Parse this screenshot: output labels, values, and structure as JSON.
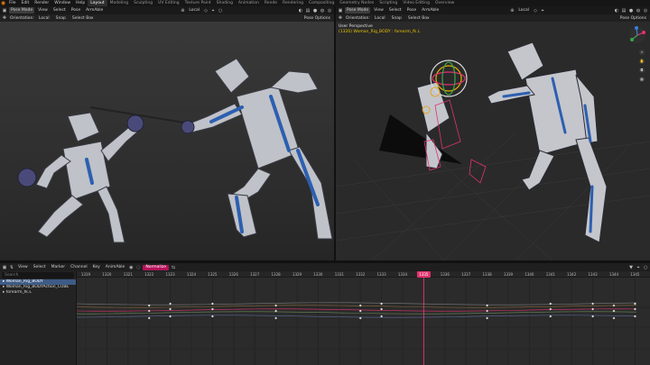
{
  "app": {
    "menu": [
      "File",
      "Edit",
      "Render",
      "Window",
      "Help"
    ],
    "workspaces": [
      "Layout",
      "Modeling",
      "Sculpting",
      "UV Editing",
      "Texture Paint",
      "Shading",
      "Animation",
      "Rende",
      "Rendering",
      "Compositing",
      "Geometry Nodes",
      "Scripting",
      "Video Editing",
      "Overview"
    ],
    "active_workspace": "Layout",
    "accent_color": "#e0336e",
    "brand_color": "#e87d0d"
  },
  "left_viewport": {
    "mode": "Pose Mode",
    "menus": [
      "View",
      "Select",
      "Pose",
      "ArmAble"
    ],
    "orientation_label": "Orientation:",
    "orientation_value": "Local",
    "snap_label": "Snap",
    "select_mode": "Select Box",
    "transform_space": "Local",
    "pose_options": "Pose Options"
  },
  "right_viewport": {
    "mode": "Pose Mode",
    "menus": [
      "View",
      "Select",
      "Pose",
      "ArmAble"
    ],
    "orientation_label": "Orientation:",
    "orientation_value": "Local",
    "snap_label": "Snap",
    "select_mode": "Select Box",
    "transform_space": "Local",
    "pose_options": "Pose Options",
    "view_name": "User Perspective",
    "object_info": "(1320) Woman_Rig_BODY : forearm_fk.L"
  },
  "graph_editor": {
    "menus": [
      "View",
      "Select",
      "Marker",
      "Channel",
      "Key",
      "AnimAble"
    ],
    "mode_label": "Normalize",
    "search_placeholder": "Search",
    "channels": [
      {
        "label": "Woman_Rig_BODY",
        "selected": true
      },
      {
        "label": "Woman_Rig_BODYAction_CUBE",
        "selected": false
      },
      {
        "label": "forearm_fk.L",
        "selected": false
      }
    ],
    "frames": [
      "1319",
      "1320",
      "1321",
      "1322",
      "1323",
      "1324",
      "1325",
      "1326",
      "1327",
      "1328",
      "1329",
      "1330",
      "1331",
      "1332",
      "1333",
      "1334",
      "1335",
      "1336",
      "1337",
      "1338",
      "1339",
      "1340",
      "1341",
      "1342",
      "1343",
      "1344",
      "1345"
    ],
    "current_frame": "1335",
    "y_labels": [
      "0",
      "-2",
      "-4"
    ]
  }
}
